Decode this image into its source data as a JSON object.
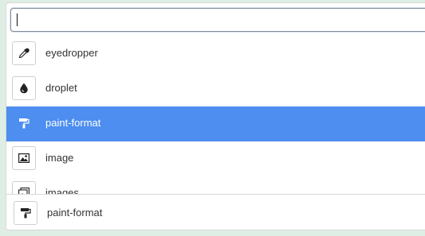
{
  "search": {
    "value": "",
    "placeholder": ""
  },
  "results": [
    {
      "label": "eyedropper",
      "icon": "eyedropper-icon",
      "selected": false
    },
    {
      "label": "droplet",
      "icon": "droplet-icon",
      "selected": false
    },
    {
      "label": "paint-format",
      "icon": "paint-format-icon",
      "selected": true
    },
    {
      "label": "image",
      "icon": "image-icon",
      "selected": false
    },
    {
      "label": "images",
      "icon": "images-icon",
      "selected": false
    }
  ],
  "footer": {
    "label": "paint-format",
    "icon": "paint-format-icon"
  },
  "colors": {
    "selection": "#4d8ef0",
    "background": "#dfeee4"
  }
}
